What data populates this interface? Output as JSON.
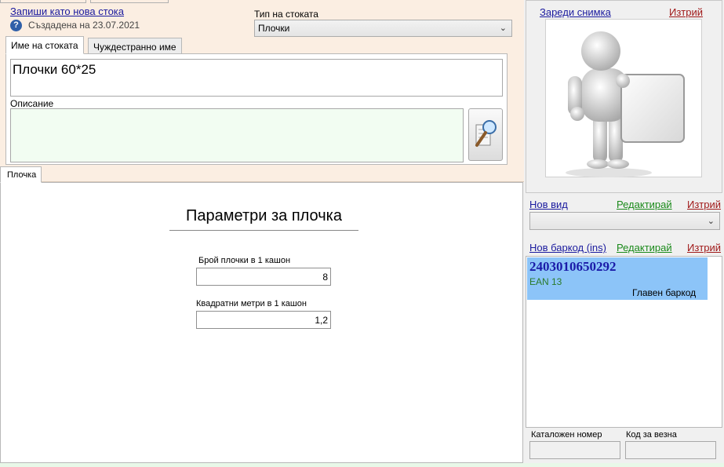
{
  "header": {
    "save_new_link": "Запиши като нова стока",
    "created_text": "Създадена на 23.07.2021"
  },
  "type": {
    "label": "Тип на стоката",
    "value": "Плочки"
  },
  "name_tabs": [
    {
      "label": "Име на стоката"
    },
    {
      "label": "Чуждестранно име"
    }
  ],
  "name_value": "Плочки 60*25",
  "description": {
    "label": "Описание",
    "value": ""
  },
  "photo": {
    "load_link": "Зареди снимка",
    "delete_link": "Изтрий"
  },
  "kind": {
    "new_link": "Нов вид",
    "edit_link": "Редактирай",
    "delete_link": "Изтрий",
    "value": ""
  },
  "barcode": {
    "new_link": "Нов баркод (ins)",
    "edit_link": "Редактирай",
    "delete_link": "Изтрий",
    "items": [
      {
        "number": "2403010650292",
        "type": "EAN 13",
        "note": "Главен баркод"
      }
    ]
  },
  "catalog": {
    "label": "Каталожен номер",
    "value": ""
  },
  "scale_code": {
    "label": "Код за везна",
    "value": ""
  },
  "tile_tab": {
    "label": "Плочка",
    "title": "Параметри за плочка",
    "tiles_per_box_label": "Брой плочки в 1 кашон",
    "tiles_per_box_value": "8",
    "sqm_per_box_label": "Квадратни метри в 1 кашон",
    "sqm_per_box_value": "1,2"
  },
  "colors": {
    "top_bg": "#fbeee2",
    "barcode_highlight": "#8cc4f8",
    "description_bg": "#f2fdf2"
  }
}
